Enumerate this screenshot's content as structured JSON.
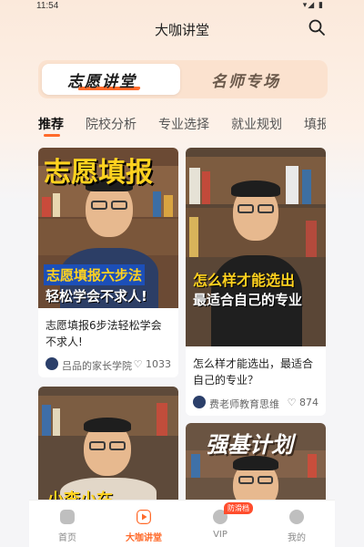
{
  "status": {
    "time": "11:54",
    "icons_right": "▾◢ ▮"
  },
  "header": {
    "title": "大咖讲堂"
  },
  "segment": {
    "items": [
      "志愿讲堂",
      "名师专场"
    ],
    "active": 0
  },
  "tabs": [
    "推荐",
    "院校分析",
    "专业选择",
    "就业规划",
    "填报指"
  ],
  "cards": [
    {
      "overlay_top": "志愿填报",
      "overlay_line1": "志愿填报六步法",
      "overlay_line2": "轻松学会不求人!",
      "caption": "志愿填报6步法轻松学会不求人!",
      "author": "吕品的家长学院",
      "likes": "1033"
    },
    {
      "overlay_line1": "怎么样才能选出",
      "overlay_line2": "最适合自己的专业",
      "caption": "怎么样才能选出，最适合自己的专业？",
      "author": "费老师教育思维",
      "likes": "874"
    },
    {
      "overlay_bottom": "小李小在"
    },
    {
      "overlay_top": "强基计划"
    }
  ],
  "bottom_nav": {
    "items": [
      "首页",
      "大咖讲堂",
      "VIP",
      "我的"
    ],
    "active": 1,
    "vip_badge": "防滑档"
  },
  "colors": {
    "accent": "#ff6a2a",
    "overlay_yellow": "#ffd21f",
    "overlay_blue": "#1c4fb8"
  }
}
